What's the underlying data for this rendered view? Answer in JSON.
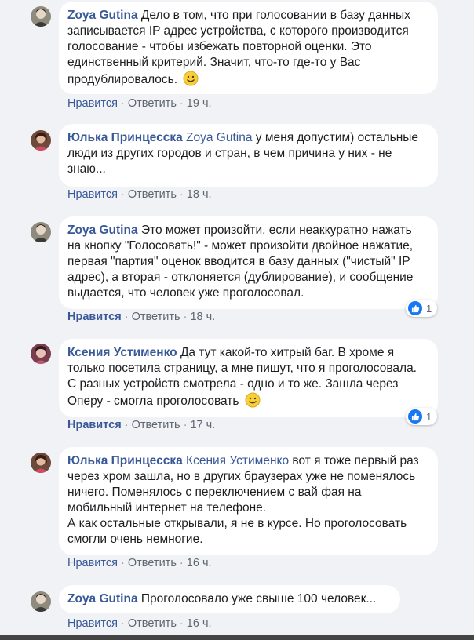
{
  "comments": [
    {
      "author": "Zoya Gutina",
      "text": "Дело в том, что при голосовании в базу данных записывается IP адрес устройства, с которого производится голосование - чтобы избежать повторной оценки. Это единственный критерий. Значит, что-то где-то у Вас продублировалось.",
      "like": "Нравится",
      "reply": "Ответить",
      "time": "19 ч."
    },
    {
      "author": "Юлька Принцесска",
      "mention": "Zoya Gutina",
      "text": "у меня допустим) остальные люди из других городов и стран, в чем причина у них - не знаю...",
      "like": "Нравится",
      "reply": "Ответить",
      "time": "18 ч."
    },
    {
      "author": "Zoya Gutina",
      "text": "Это может произойти, если неаккуратно нажать на кнопку \"Голосовать!\" - может произойти двойное нажатие, первая \"партия\" оценок вводится в базу данных (\"чистый\" IP адрес), а вторая - отклоняется (дублирование), и сообщение выдается, что человек уже проголосовал.",
      "like": "Нравится",
      "reply": "Ответить",
      "time": "18 ч.",
      "reactions": "1"
    },
    {
      "author": "Ксения Устименко",
      "text": "Да тут какой-то хитрый баг. В хроме я только посетила страницу, а мне пишут, что я проголосовала. С разных устройств смотрела - одно и то же. Зашла через Оперу - смогла проголосовать",
      "like": "Нравится",
      "reply": "Ответить",
      "time": "17 ч.",
      "reactions": "1"
    },
    {
      "author": "Юлька Принцесска",
      "mention": "Ксения Устименко",
      "text": "вот я тоже первый раз через хром зашла, но в других браузерах уже не поменялось ничего. Поменялось с переключением с вай фая на мобильный интернет на телефоне.",
      "text2": "А как остальные открывали, я не в курсе. Но проголосовать смогли очень немногие.",
      "like": "Нравится",
      "reply": "Ответить",
      "time": "16 ч."
    },
    {
      "author": "Zoya Gutina",
      "text": "Проголосовало уже свыше 100 человек...",
      "like": "Нравится",
      "reply": "Ответить",
      "time": "16 ч."
    }
  ],
  "colors": {
    "link": "#385898",
    "background": "#f0f2f5",
    "like_badge": "#1877f2"
  },
  "icons": [
    "avatar",
    "smile-emoji-icon",
    "like-reaction-icon"
  ]
}
